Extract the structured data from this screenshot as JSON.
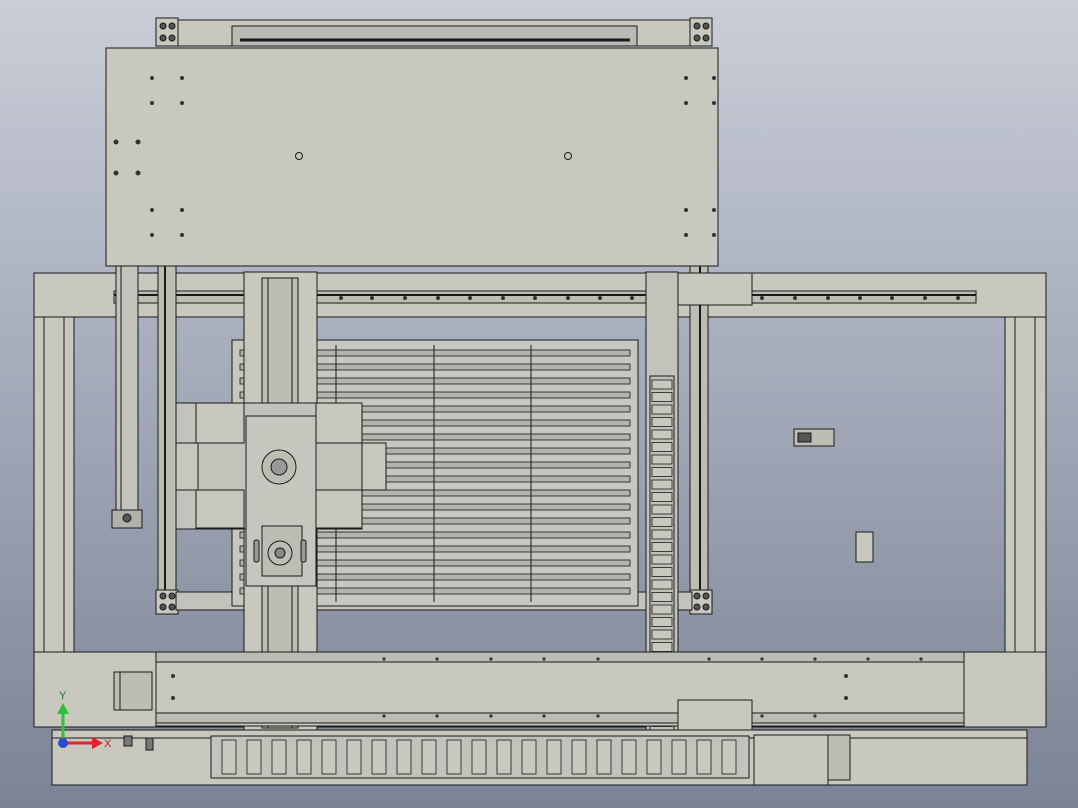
{
  "viewport": {
    "background_top": "#c9ced8",
    "background_bottom": "#7b8396",
    "part_fill": "#c8c8bf",
    "part_fill_dark": "#a9aaa1",
    "edge_color": "#1a1a1a"
  },
  "triad": {
    "y_label": "Y",
    "x_label": "X",
    "y_color": "#2fbf3a",
    "x_color": "#e0222a",
    "origin_color": "#2a4bd0"
  }
}
